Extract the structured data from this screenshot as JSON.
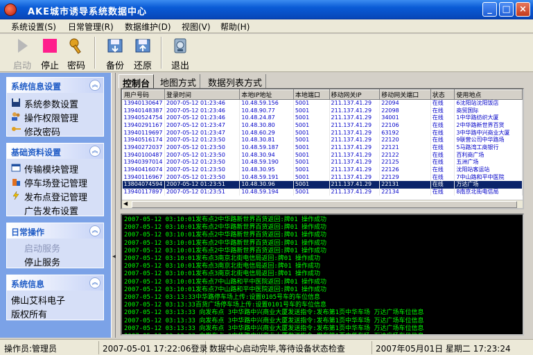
{
  "window": {
    "title": "AKE城市诱导系统数据中心",
    "min_label": "_",
    "max_label": "□",
    "close_label": "×"
  },
  "menu": [
    "系统设置(S)",
    "日常管理(R)",
    "数据维护(D)",
    "视图(V)",
    "帮助(H)"
  ],
  "toolbar": {
    "start": "启动",
    "stop": "停止",
    "password": "密码",
    "backup": "备份",
    "restore": "还原",
    "exit": "退出"
  },
  "sidebar": {
    "groups": [
      {
        "title": "系统信息设置",
        "items": [
          "系统参数设置",
          "操作权限管理",
          "修改密码"
        ]
      },
      {
        "title": "基础资料设置",
        "items": [
          "传输模块管理",
          "停车场登记管理",
          "发布点登记管理",
          "广告发布设置"
        ]
      },
      {
        "title": "日常操作",
        "items": [
          "启动服务",
          "停止服务"
        ]
      },
      {
        "title": "系统信息",
        "items": [
          "佛山艾科电子",
          "版权所有"
        ]
      }
    ],
    "chev": "︽"
  },
  "tabs": [
    "控制台",
    "地图方式",
    "数据列表方式"
  ],
  "grid": {
    "columns": [
      "用户号码",
      "登录时间",
      "本地IP地址",
      "本地端口",
      "移动网关IP",
      "移动网关端口",
      "状态",
      "使用地点"
    ],
    "rows": [
      [
        "13940130647",
        "2007-05-12 01:23:46",
        "10.48.59.156",
        "5001",
        "211.137.41.29",
        "22094",
        "在线",
        "6沈阳站沈阳饭店"
      ],
      [
        "13940148387",
        "2007-05-12 01:23:46",
        "10.48.90.77",
        "5001",
        "211.137.41.29",
        "22098",
        "在线",
        "商贸国际"
      ],
      [
        "13940524754",
        "2007-05-12 01:23:46",
        "10.48.24.87",
        "5001",
        "211.137.41.29",
        "34001",
        "在线",
        "1中华路纺织大厦"
      ],
      [
        "13940291167",
        "2007-05-12 01:23:47",
        "10.48.30.80",
        "5001",
        "211.137.41.29",
        "22106",
        "在线",
        "2中华路新世界百货"
      ],
      [
        "13940119697",
        "2007-05-12 01:23:47",
        "10.48.60.29",
        "5001",
        "211.137.41.29",
        "63192",
        "在线",
        "3中华路中兴商业大厦"
      ],
      [
        "13940516174",
        "2007-05-12 01:23:50",
        "10.48.30.81",
        "5001",
        "211.137.41.29",
        "22120",
        "在线",
        "9联营公司中华路场"
      ],
      [
        "13940272037",
        "2007-05-12 01:23:50",
        "10.48.59.187",
        "5001",
        "211.137.41.29",
        "22121",
        "在线",
        "5马路湾工商银行"
      ],
      [
        "13940100487",
        "2007-05-12 01:23:50",
        "10.48.30.94",
        "5001",
        "211.137.41.29",
        "22122",
        "在线",
        "百利商广场"
      ],
      [
        "13940397014",
        "2007-05-12 01:23:50",
        "10.48.59.190",
        "5001",
        "211.137.41.29",
        "22125",
        "在线",
        "五洲广场"
      ],
      [
        "13940416074",
        "2007-05-12 01:23:50",
        "10.48.30.95",
        "5001",
        "211.137.41.29",
        "22126",
        "在线",
        "沈阳站客运站"
      ],
      [
        "13940116967",
        "2007-05-12 01:23:50",
        "10.48.59.191",
        "5001",
        "211.137.41.29",
        "22129",
        "在线",
        "7中山路和平中医院"
      ],
      [
        "13804074594",
        "2007-05-12 01:23:51",
        "10.48.30.96",
        "5001",
        "211.137.41.29",
        "22131",
        "在线",
        "万达广场"
      ],
      [
        "13940117897",
        "2007-05-12 01:23:51",
        "10.48.59.194",
        "5001",
        "211.137.41.29",
        "22134",
        "在线",
        "8南京北街电信局"
      ]
    ],
    "selected_row": 11
  },
  "log": [
    "2007-05-12 03:10:01发布点2中华路新世界百货返回:牌01 操作成功",
    "2007-05-12 03:10:01发布点2中华路新世界百货返回:牌01 操作成功",
    "2007-05-12 03:10:01发布点2中华路新世界百货返回:牌01 操作成功",
    "2007-05-12 03:10:01发布点2中华路新世界百货返回:牌01 操作成功",
    "2007-05-12 03:10:01发布点2中华路新世界百货返回:牌01 操作成功",
    "2007-05-12 03:10:01发布点3南京北街电信局返回:牌01 操作成功",
    "2007-05-12 03:10:01发布点3南京北街电信局返回:牌01 操作成功",
    "2007-05-12 03:10:01发布点3南京北街电信局返回:牌01 操作成功",
    "2007-05-12 03:10:01发布点7中山路和平中医院返回:牌01 操作成功",
    "2007-05-12 03:10:01发布点7中山路和平中医院返回:牌01 操作成功",
    "2007-05-12 03:13:33中华路停车场上传:设置0105号车的车位信息",
    "2007-05-12 03:13:33百货广场停车场上传:设置0101号车的车位信息",
    "2007-05-12 03:13:33  向发布点  3中华路中兴商业大厦发送指令:发布第1页中华车场  万达广场车位信息",
    "2007-05-12 03:13:33  向发布点  3中华路中兴商业大厦发送指令:发布第1页中华车场  万达广场车位信息",
    "2007-05-12 03:13:33  向发布点  3中华路中兴商业大厦发送指令:发布第1页中华车场  万达广场车位信息",
    "2007-05-12 03:13:33  向发布点  3中华路中兴商业大厦发送指令:发布第1页中华车场  万达广场车位信息",
    "2007-05-12 03:13:33  向发布点  3中华路中兴商业大厦发送指令:发布第1页中华车场  万达广场车位信息"
  ],
  "status": {
    "operator": "操作员:管理员",
    "login": "2007-05-01 17:22:06登录",
    "message": "数据中心启动完毕,等待设备状态检查",
    "datetime": "2007年05月01日 星期二 17:23:24"
  },
  "colors": {
    "title": "#0a5bd6",
    "sidebar": "#7ba2e7",
    "log_text": "#00ff00",
    "grid_text": "#0000c8",
    "stop": "#ff1e8c"
  }
}
